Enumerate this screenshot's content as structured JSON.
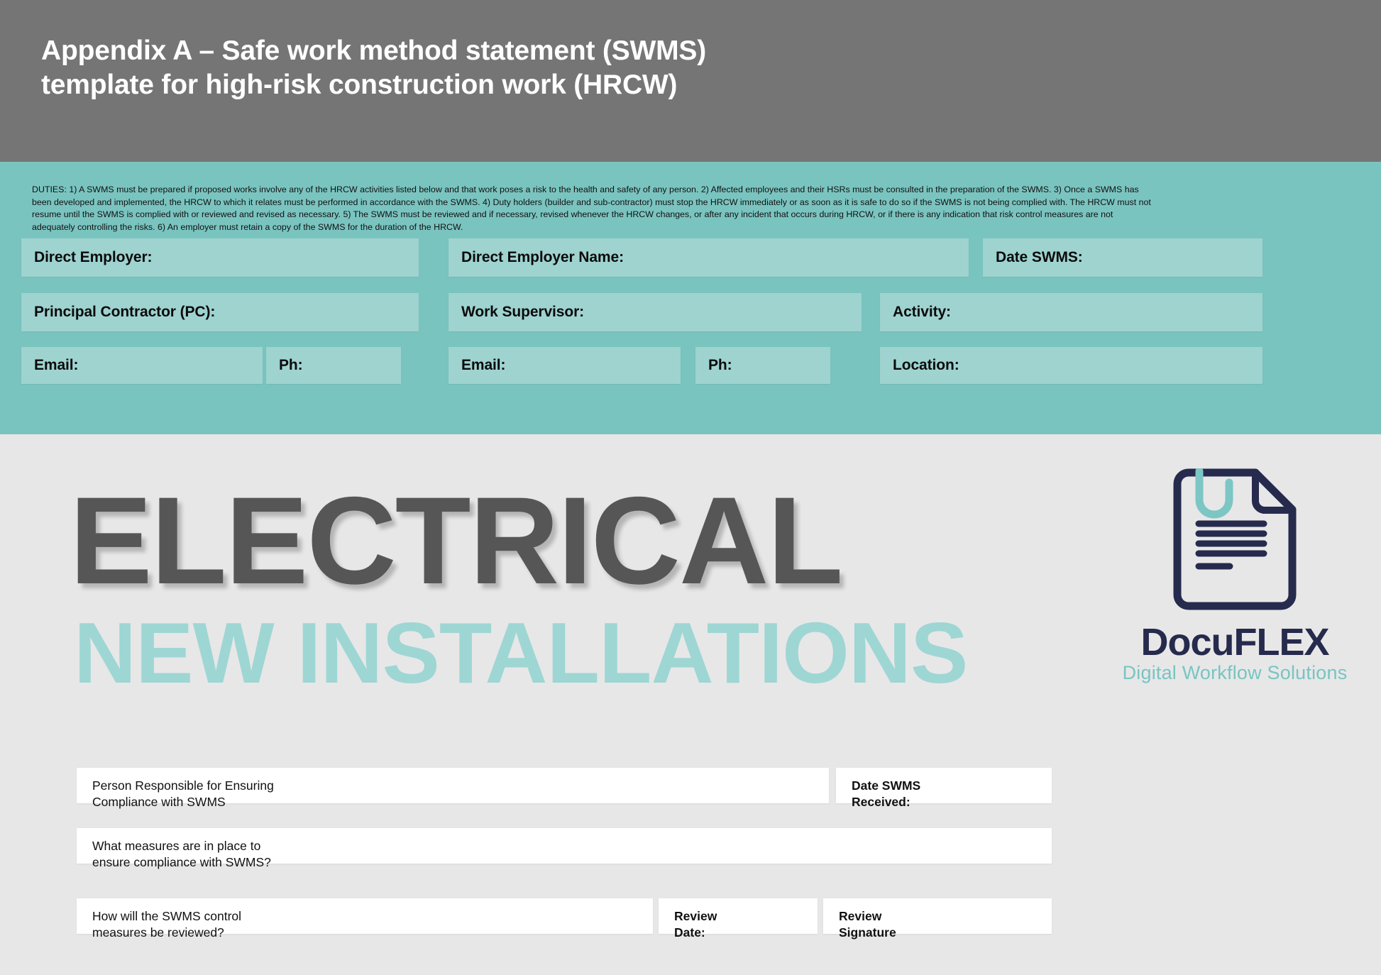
{
  "header": {
    "title": "Appendix A – Safe work method statement (SWMS)\ntemplate for high-risk construction work (HRCW)",
    "background_color": "#757575"
  },
  "duties": {
    "text": "DUTIES: 1) A SWMS must be prepared if proposed works involve any of the HRCW activities listed below and that work poses a risk to the health and safety of any person. 2) Affected employees and their HSRs must be consulted in the preparation of the SWMS. 3) Once a SWMS has been developed and implemented, the HRCW to which it relates must be performed in accordance with the SWMS. 4) Duty holders (builder and sub-contractor) must stop the HRCW immediately or as soon as it is safe to do so if the SWMS is not being complied with. The HRCW must not resume until the SWMS is complied with or reviewed and revised as necessary. 5) The SWMS must be reviewed and if necessary, revised whenever the HRCW changes, or after any incident that occurs during HRCW, or if there is any indication that risk control measures are not adequately controlling the risks. 6) An employer must retain a copy of the SWMS for the duration of the HRCW."
  },
  "band": {
    "background_color": "#7ac4c0",
    "field_color": "#9ed3d0",
    "fields": {
      "direct_employer": "Direct Employer:",
      "direct_employer_name": "Direct Employer Name:",
      "date_swms": "Date SWMS:",
      "principal_contractor": "Principal Contractor (PC):",
      "work_supervisor": "Work Supervisor:",
      "activity": "Activity:",
      "email_1": "Email:",
      "ph_1": "Ph:",
      "email_2": "Email:",
      "ph_2": "Ph:",
      "location": "Location:"
    }
  },
  "watermark": {
    "main": "ELECTRICAL",
    "sub": "NEW INSTALLATIONS",
    "main_color": "#565656",
    "sub_color": "#9ed6d4"
  },
  "logo": {
    "name": "DocuFLEX",
    "tagline": "Digital Workflow Solutions",
    "name_color": "#262a4d",
    "tagline_color": "#79c4c2"
  },
  "bottom_form": {
    "person_responsible": "Person Responsible for Ensuring\nCompliance with SWMS",
    "date_swms_received": "Date SWMS\nReceived:",
    "measures_in_place": "What measures are in place to\nensure compliance with SWMS?",
    "review_method": "How will the SWMS control\nmeasures be reviewed?",
    "review_date": "Review\nDate:",
    "review_signature": "Review\nSignature"
  },
  "page_background": "#e7e7e7"
}
